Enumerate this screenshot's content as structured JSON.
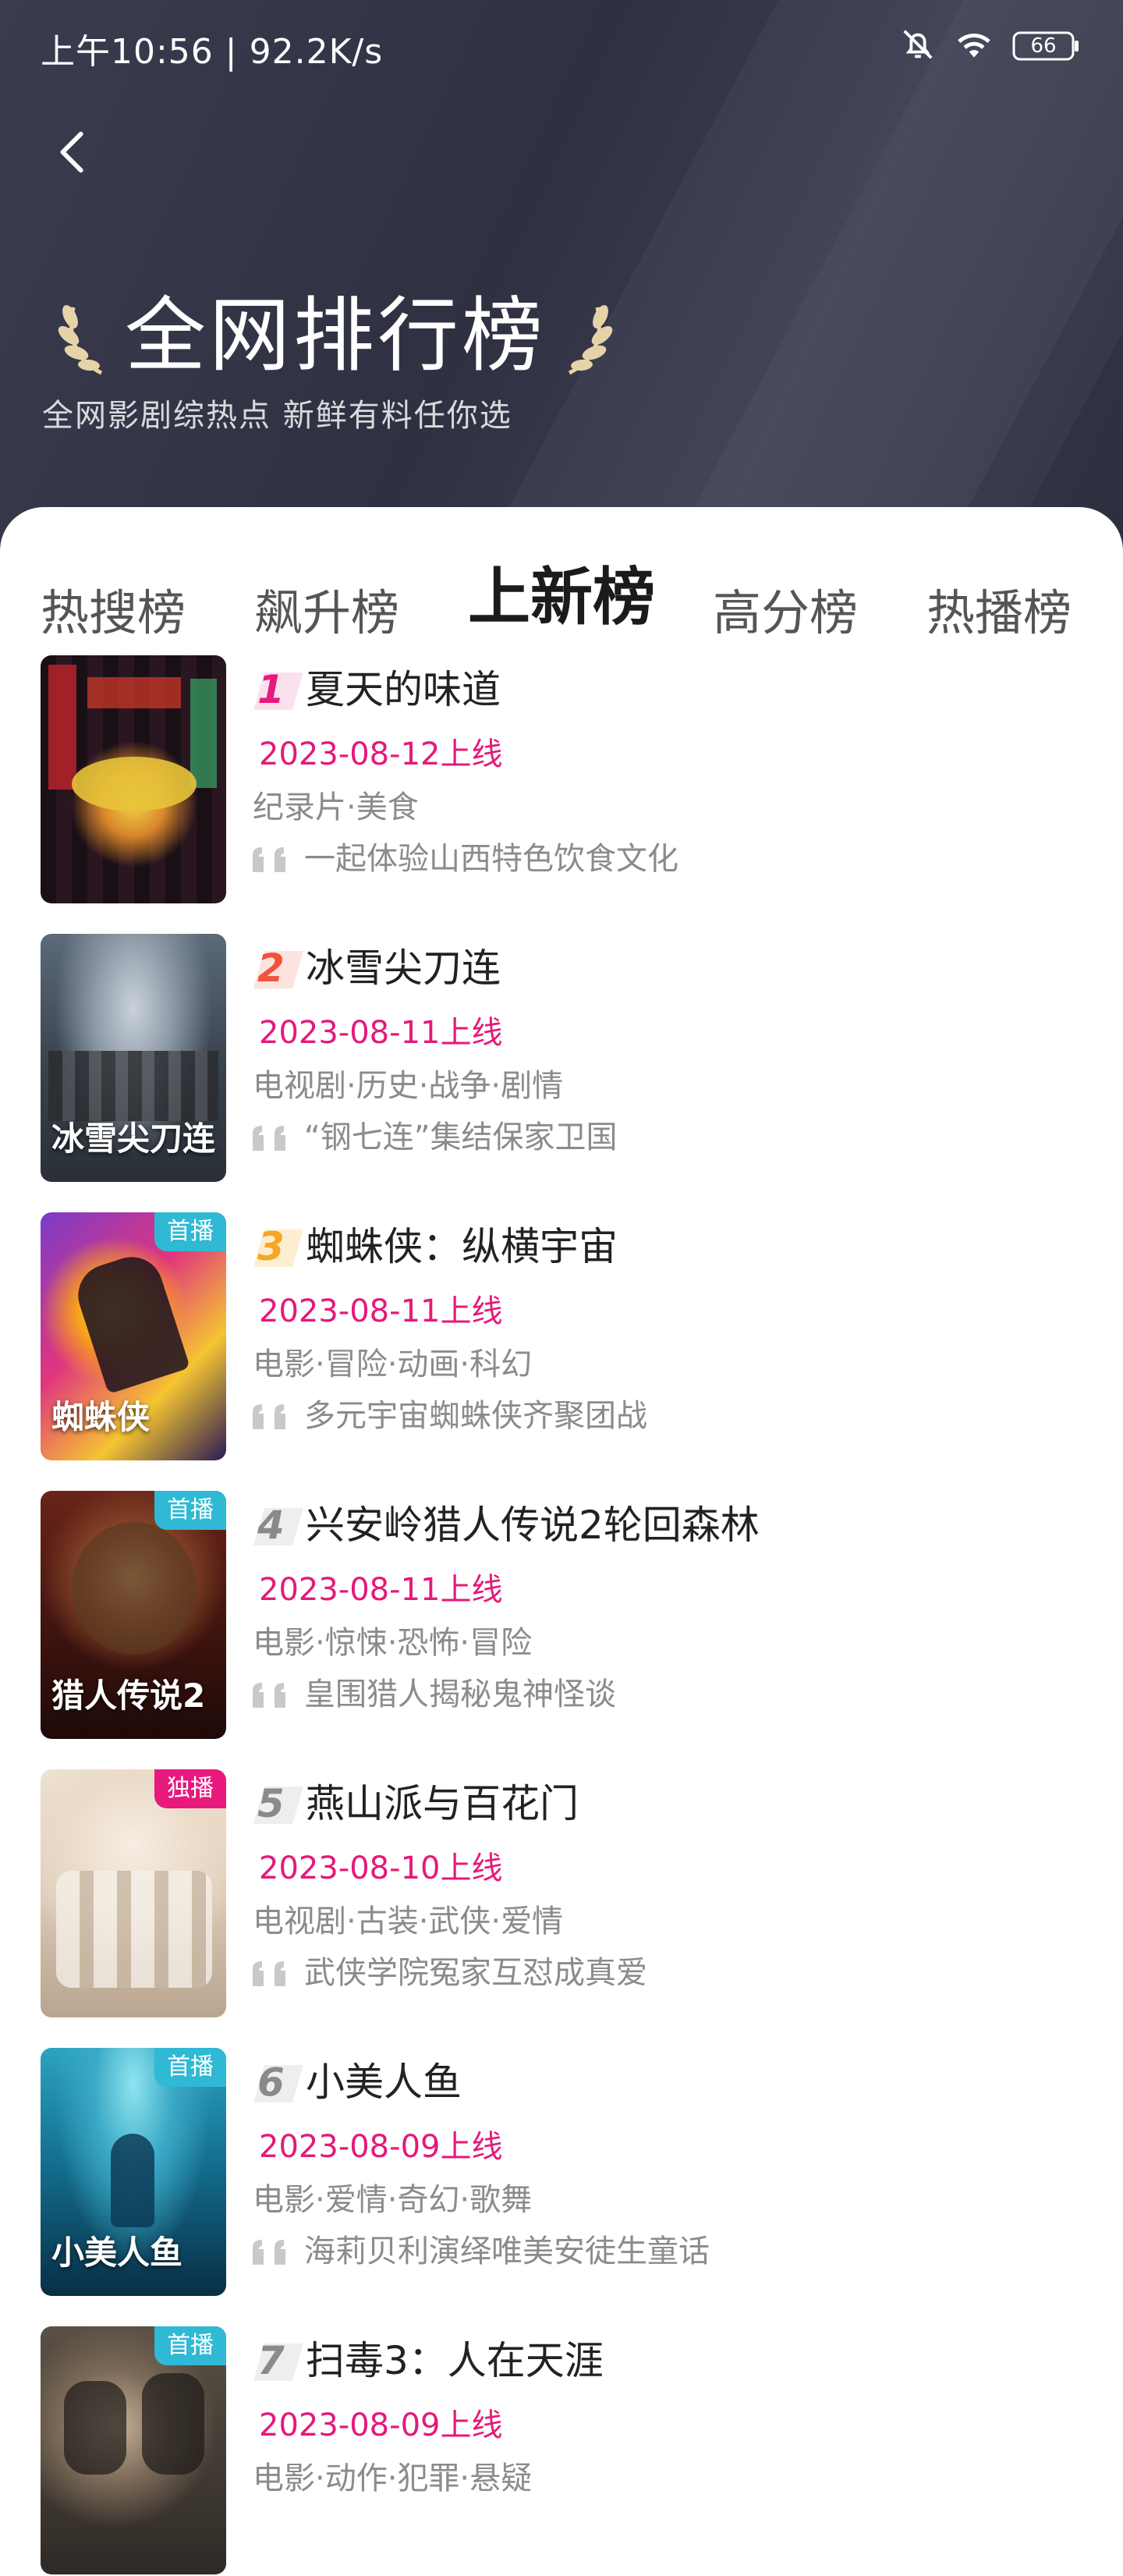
{
  "status_bar": {
    "time": "上午10:56 | 92.2K/s",
    "battery": "66",
    "icons": [
      "mute-bell-icon",
      "wifi-icon",
      "battery-icon"
    ]
  },
  "header": {
    "back_icon": "chevron-left-icon",
    "title": "全网排行榜",
    "subtitle": "全网影剧综热点  新鲜有料任你选",
    "decor_icon": "laurel-icon"
  },
  "tabs": [
    {
      "label": "热搜榜",
      "active": false
    },
    {
      "label": "飙升榜",
      "active": false
    },
    {
      "label": "上新榜",
      "active": true
    },
    {
      "label": "高分榜",
      "active": false
    },
    {
      "label": "热播榜",
      "active": false
    }
  ],
  "colors": {
    "header_bg": "#30323f",
    "accent_date": "#e5197a",
    "tag_first": "#2fb9d4",
    "tag_exclusive": "#e8197c",
    "rank1": "#e8197c",
    "rank2": "#f0543a",
    "rank3": "#f5a623",
    "rank_other": "#8a8a8a"
  },
  "items": [
    {
      "rank": "1",
      "title": "夏天的味道",
      "date": "2023-08-12上线",
      "genre": "纪录片·美食",
      "quote": "一起体验山西特色饮食文化",
      "tag": ""
    },
    {
      "rank": "2",
      "title": "冰雪尖刀连",
      "date": "2023-08-11上线",
      "genre": "电视剧·历史·战争·剧情",
      "quote": "“钢七连”集结保家卫国",
      "tag": ""
    },
    {
      "rank": "3",
      "title": "蜘蛛侠：纵横宇宙",
      "date": "2023-08-11上线",
      "genre": "电影·冒险·动画·科幻",
      "quote": "多元宇宙蜘蛛侠齐聚团战",
      "tag": "首播"
    },
    {
      "rank": "4",
      "title": "兴安岭猎人传说2轮回森林",
      "date": "2023-08-11上线",
      "genre": "电影·惊悚·恐怖·冒险",
      "quote": "皇围猎人揭秘鬼神怪谈",
      "tag": "首播"
    },
    {
      "rank": "5",
      "title": "燕山派与百花门",
      "date": "2023-08-10上线",
      "genre": "电视剧·古装·武侠·爱情",
      "quote": "武侠学院冤家互怼成真爱",
      "tag": "独播"
    },
    {
      "rank": "6",
      "title": "小美人鱼",
      "date": "2023-08-09上线",
      "genre": "电影·爱情·奇幻·歌舞",
      "quote": "海莉贝利演绎唯美安徒生童话",
      "tag": "首播"
    },
    {
      "rank": "7",
      "title": "扫毒3：人在天涯",
      "date": "2023-08-09上线",
      "genre": "电影·动作·犯罪·悬疑",
      "quote": "",
      "tag": "首播"
    }
  ],
  "posters": [
    {
      "text": ""
    },
    {
      "text": "冰雪尖刀连"
    },
    {
      "text": "蜘蛛侠"
    },
    {
      "text": "猎人传说2"
    },
    {
      "text": ""
    },
    {
      "text": "小美人鱼"
    },
    {
      "text": ""
    }
  ]
}
